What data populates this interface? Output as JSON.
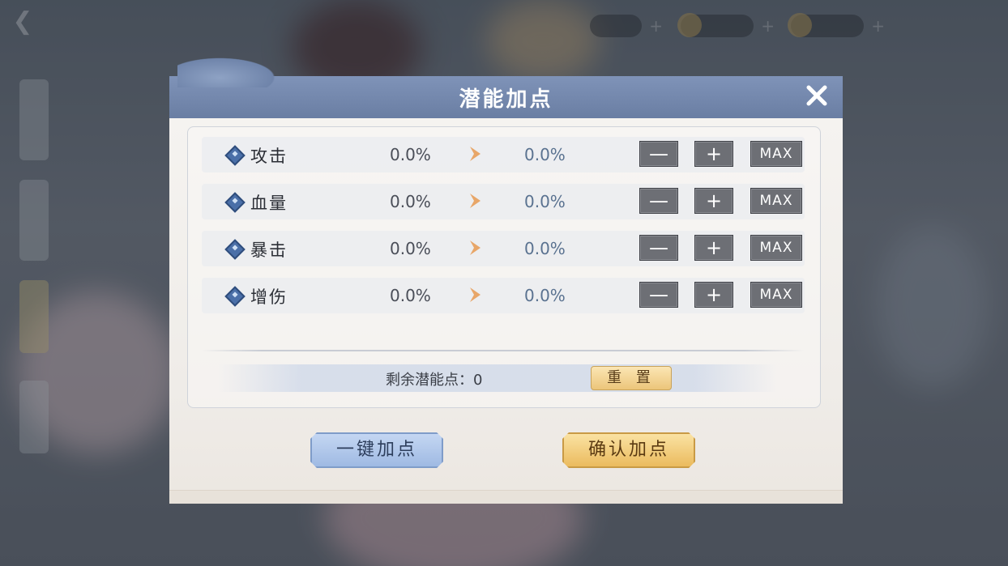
{
  "dialog": {
    "title": "潜能加点",
    "close_icon": "close-x-icon"
  },
  "stats": [
    {
      "label": "攻击",
      "current": "0.0%",
      "next": "0.0%"
    },
    {
      "label": "血量",
      "current": "0.0%",
      "next": "0.0%"
    },
    {
      "label": "暴击",
      "current": "0.0%",
      "next": "0.0%"
    },
    {
      "label": "增伤",
      "current": "0.0%",
      "next": "0.0%"
    }
  ],
  "controls": {
    "minus": "—",
    "plus": "+",
    "max": "MAX"
  },
  "remaining": {
    "label": "剩余潜能点：0",
    "reset_label": "重 置"
  },
  "buttons": {
    "auto_label": "一键加点",
    "confirm_label": "确认加点"
  },
  "colors": {
    "header": "#7f93b8",
    "gold_button": "#eab95b",
    "blue_button": "#9db8e2",
    "next_value": "#5a7290",
    "arrow": "#e8a668"
  }
}
